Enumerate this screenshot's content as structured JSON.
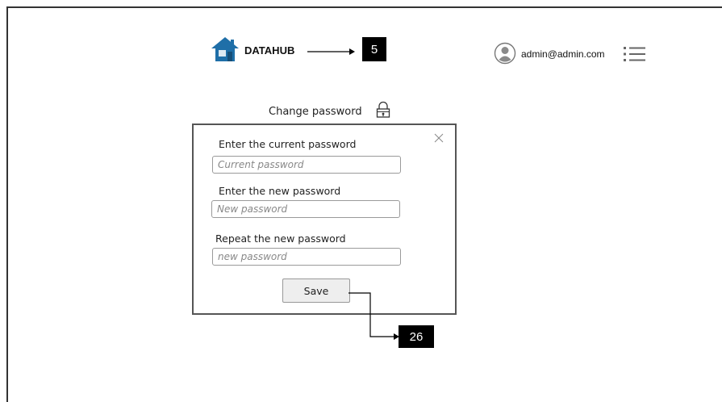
{
  "header": {
    "logo_text": "DATAHUB",
    "callout_logo": "5",
    "user_email": "admin@admin.com",
    "icons": {
      "logo": "house-logo-icon",
      "avatar": "user-avatar-icon",
      "menu": "list-menu-icon"
    }
  },
  "dialog": {
    "title": "Change password",
    "title_icon": "lock-icon",
    "close_icon": "close-icon",
    "fields": [
      {
        "label": "Enter the current password",
        "placeholder": "Current password"
      },
      {
        "label": "Enter the new password",
        "placeholder": "New password"
      },
      {
        "label": "Repeat the new password",
        "placeholder": "new password"
      }
    ],
    "save_label": "Save",
    "callout_save": "26"
  },
  "colors": {
    "logo_blue": "#1f6fa8",
    "callout_bg": "#000000",
    "avatar_gray": "#8a8a8a"
  }
}
